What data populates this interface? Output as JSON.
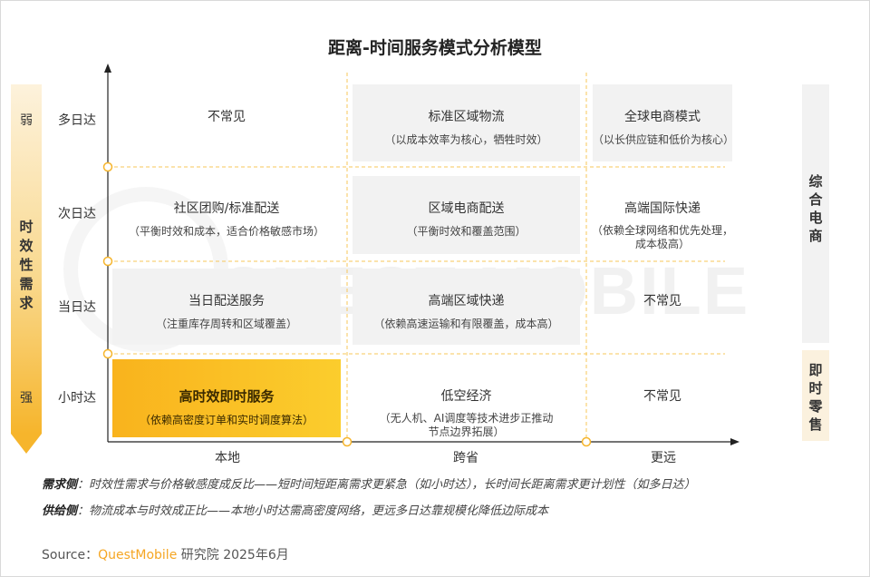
{
  "title": "距离-时间服务模式分析模型",
  "watermark": "QUEST MOBILE",
  "left_axis": {
    "weak": "弱",
    "strong": "强",
    "title": "时效性需求"
  },
  "right_labels": {
    "a": "综合电商",
    "b": "即时零售"
  },
  "rows": [
    "多日达",
    "次日达",
    "当日达",
    "小时达"
  ],
  "cols": [
    "本地",
    "跨省",
    "更远"
  ],
  "cells": [
    [
      {
        "main": "不常见",
        "sub": ""
      },
      {
        "main": "标准区域物流",
        "sub": "（以成本效率为核心，牺牲时效）"
      },
      {
        "main": "全球电商模式",
        "sub": "（以长供应链和低价为核心）"
      }
    ],
    [
      {
        "main": "社区团购/标准配送",
        "sub": "（平衡时效和成本，适合价格敏感市场）"
      },
      {
        "main": "区域电商配送",
        "sub": "（平衡时效和覆盖范围）"
      },
      {
        "main": "高端国际快递",
        "sub": "（依赖全球网络和优先处理，\n成本极高）"
      }
    ],
    [
      {
        "main": "当日配送服务",
        "sub": "（注重库存周转和区域覆盖）"
      },
      {
        "main": "高端区域快递",
        "sub": "（依赖高速运输和有限覆盖，成本高）"
      },
      {
        "main": "不常见",
        "sub": ""
      }
    ],
    [
      {
        "main": "高时效即时服务",
        "sub": "（依赖高密度订单和实时调度算法）"
      },
      {
        "main": "低空经济",
        "sub": "（无人机、AI调度等技术进步正推动\n节点边界拓展）"
      },
      {
        "main": "不常见",
        "sub": ""
      }
    ]
  ],
  "notes": {
    "demand_label": "需求侧",
    "demand_text": "：时效性需求与价格敏感度成反比——短时间短距离需求更紧急（如小时达），长时间长距离需求更计划性（如多日达）",
    "supply_label": "供给侧",
    "supply_text": "：物流成本与时效成正比——本地小时达需高密度网络，更远多日达靠规模化降低边际成本"
  },
  "source": {
    "prefix": "Source：",
    "brand": "QuestMobile",
    "suffix": " 研究院 2025年6月"
  },
  "colors": {
    "accent": "#f5a623",
    "grid": "#f7c75a",
    "gold": "#f9b31d",
    "grey_cell": "#f2f2f2"
  }
}
